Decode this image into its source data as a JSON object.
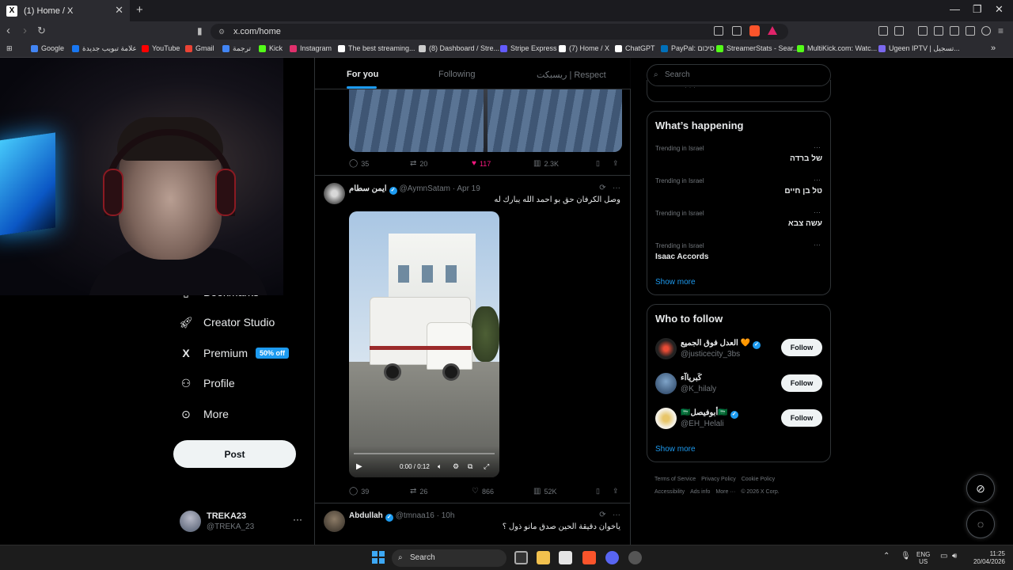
{
  "browser": {
    "tab_title": "(1) Home / X",
    "url": "x.com/home",
    "bookmarks": [
      {
        "label": "Google",
        "color": "#4285f4"
      },
      {
        "label": "علامة تبويب جديدة",
        "color": "#1877f2"
      },
      {
        "label": "YouTube",
        "color": "#ff0000"
      },
      {
        "label": "Gmail",
        "color": "#ea4335"
      },
      {
        "label": "ترجمة",
        "color": "#4285f4"
      },
      {
        "label": "Kick",
        "color": "#53fc18"
      },
      {
        "label": "Instagram",
        "color": "#e1306c"
      },
      {
        "label": "The best streaming...",
        "color": "#ffffff"
      },
      {
        "label": "(8) Dashboard / Stre...",
        "color": "#cccccc"
      },
      {
        "label": "Stripe Express",
        "color": "#635bff"
      },
      {
        "label": "(7) Home / X",
        "color": "#ffffff"
      },
      {
        "label": "ChatGPT",
        "color": "#ffffff"
      },
      {
        "label": "PayPal: סיכום",
        "color": "#0070ba"
      },
      {
        "label": "StreamerStats - Sear...",
        "color": "#53fc18"
      },
      {
        "label": "MultiKick.com: Watc...",
        "color": "#53fc18"
      },
      {
        "label": "Ugeen IPTV | تسجيل...",
        "color": "#7b68ee"
      }
    ]
  },
  "sidebar": {
    "items": [
      {
        "label": "Bookmarks",
        "icon": "bookmark-icon"
      },
      {
        "label": "Creator Studio",
        "icon": "rocket-icon"
      },
      {
        "label": "Premium",
        "icon": "x-logo-icon",
        "badge": "50% off"
      },
      {
        "label": "Profile",
        "icon": "person-icon"
      },
      {
        "label": "More",
        "icon": "more-circle-icon"
      }
    ],
    "post_label": "Post",
    "account": {
      "name": "TREKA23",
      "handle": "@TREKA_23"
    }
  },
  "timeline": {
    "tabs": [
      "For you",
      "Following",
      "ريسبكت | Respect"
    ],
    "prev_post_stats": {
      "replies": "35",
      "reposts": "20",
      "likes": "117",
      "views": "2.3K"
    },
    "posts": [
      {
        "name": "ايمن سطام",
        "handle": "@AymnSatam",
        "date": "Apr 19",
        "text": "وصل الكرفان حق بو احمد الله يبارك له",
        "video": {
          "time": "0:00 / 0:12",
          "progress": 0
        },
        "stats": {
          "replies": "39",
          "reposts": "26",
          "likes": "866",
          "views": "52K"
        }
      },
      {
        "name": "Abdullah",
        "handle": "@tmnaa16",
        "date": "10h",
        "text": "ياخوان دقيقة الحين صدق مانو ذول ؟"
      }
    ]
  },
  "right": {
    "search_placeholder": "Search",
    "trending_title": "What’s happening",
    "trends": [
      {
        "context": "Trending in Israel",
        "name": "של ברדה"
      },
      {
        "context": "Trending in Israel",
        "name": "טל בן חיים"
      },
      {
        "context": "Trending in Israel",
        "name": "עשה צבא"
      },
      {
        "context": "Trending in Israel",
        "name": "Isaac Accords"
      }
    ],
    "show_more": "Show more",
    "wtf_title": "Who to follow",
    "who_to_follow": [
      {
        "name": "العدل فوق الجميع 🧡",
        "handle": "@justicecity_3bs",
        "verified": true
      },
      {
        "name": "كَبرياآء",
        "handle": "@K_hilaly",
        "verified": false
      },
      {
        "name": "🇸🇦أبوفيصل🇸🇦",
        "handle": "@EH_Helali",
        "verified": true
      }
    ],
    "follow_label": "Follow",
    "footer": [
      "Terms of Service",
      "Privacy Policy",
      "Cookie Policy",
      "Accessibility",
      "Ads info",
      "More ···",
      "© 2026 X Corp."
    ]
  },
  "taskbar": {
    "search_label": "Search",
    "lang": "ENG",
    "region": "US",
    "time": "11:25",
    "date": "20/04/2026"
  }
}
